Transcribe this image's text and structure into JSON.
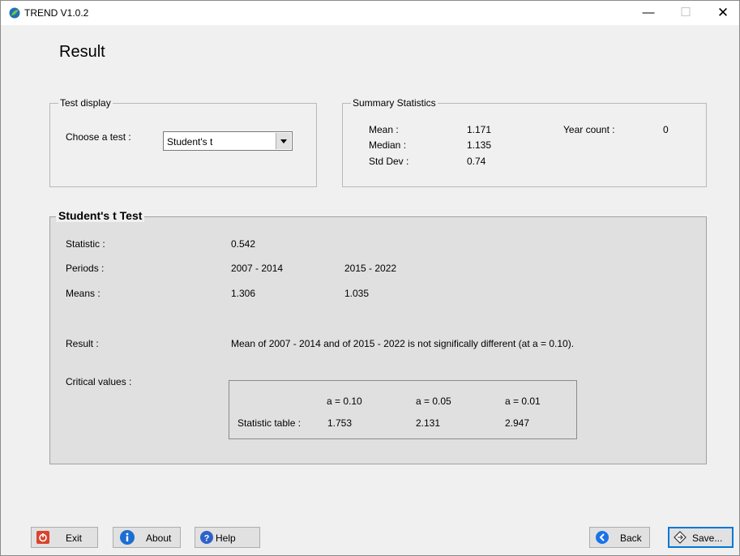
{
  "window": {
    "title": "TREND V1.0.2",
    "minimize_glyph": "—",
    "maximize_glyph": "☐",
    "close_glyph": "✕"
  },
  "page": {
    "title": "Result"
  },
  "test_display": {
    "legend": "Test display",
    "choose_label": "Choose a test :",
    "selected_test": "Student's t"
  },
  "summary": {
    "legend": "Summary Statistics",
    "mean_label": "Mean :",
    "mean_value": "1.171",
    "median_label": "Median :",
    "median_value": "1.135",
    "std_label": "Std Dev :",
    "std_value": "0.74",
    "year_count_label": "Year count :",
    "year_count_value": "0"
  },
  "test": {
    "legend": "Student's t Test",
    "statistic_label": "Statistic  :",
    "statistic_value": "0.542",
    "periods_label": "Periods :",
    "period1": "2007 - 2014",
    "period2": "2015 - 2022",
    "means_label": "Means :",
    "mean1": "1.306",
    "mean2": "1.035",
    "result_label": "Result :",
    "result_text": "Mean of 2007 - 2014 and of 2015 - 2022 is not significally different (at a = 0.10).",
    "critical_label": "Critical values :",
    "critical": {
      "headers": [
        "a = 0.10",
        "a = 0.05",
        "a = 0.01"
      ],
      "row_label": "Statistic table :",
      "values": [
        "1.753",
        "2.131",
        "2.947"
      ]
    }
  },
  "buttons": {
    "exit": "Exit",
    "about": "About",
    "help": "Help",
    "back": "Back",
    "save": "Save..."
  },
  "colors": {
    "exit_icon": "#d9442e",
    "about_icon": "#1c6fd1",
    "help_icon": "#2d62c8",
    "back_icon": "#1a73e8",
    "app_icon": "#1f6fb5",
    "panel_bg": "#e0e0e0"
  }
}
